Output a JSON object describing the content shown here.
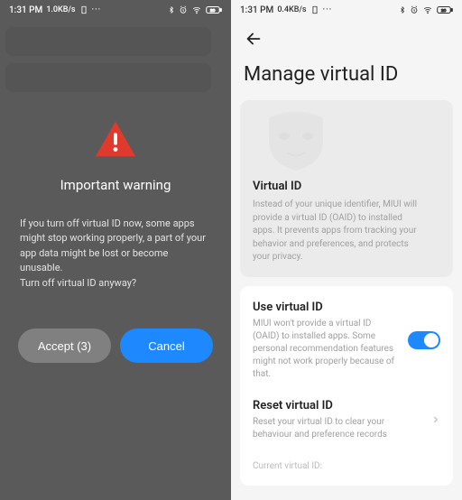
{
  "statusbar": {
    "left_time": "1:31 PM",
    "left_speed": "1.0KB/s",
    "right_time": "1:31 PM",
    "right_speed": "0.4KB/s"
  },
  "left": {
    "dialog_title": "Important warning",
    "dialog_body": "If you turn off virtual ID now, some apps might stop working properly, a part of your app data might be lost or become unusable.\nTurn off virtual ID anyway?",
    "accept_label": "Accept (3)",
    "cancel_label": "Cancel"
  },
  "right": {
    "page_title": "Manage virtual ID",
    "card": {
      "title": "Virtual ID",
      "desc": "Instead of your unique identifier, MIUI will provide a virtual ID (OAID) to installed apps. It prevents apps from tracking your behavior and preferences, and protects your privacy."
    },
    "use": {
      "title": "Use virtual ID",
      "desc": "MIUI won't provide a virtual ID (OAID) to installed apps. Some personal recommendation features might not work properly because of that.",
      "enabled": true
    },
    "reset": {
      "title": "Reset virtual ID",
      "desc": "Reset your virtual ID to clear your behaviour and preference records"
    },
    "current_id_label": "Current virtual ID:"
  },
  "colors": {
    "accent": "#1e88ff"
  }
}
